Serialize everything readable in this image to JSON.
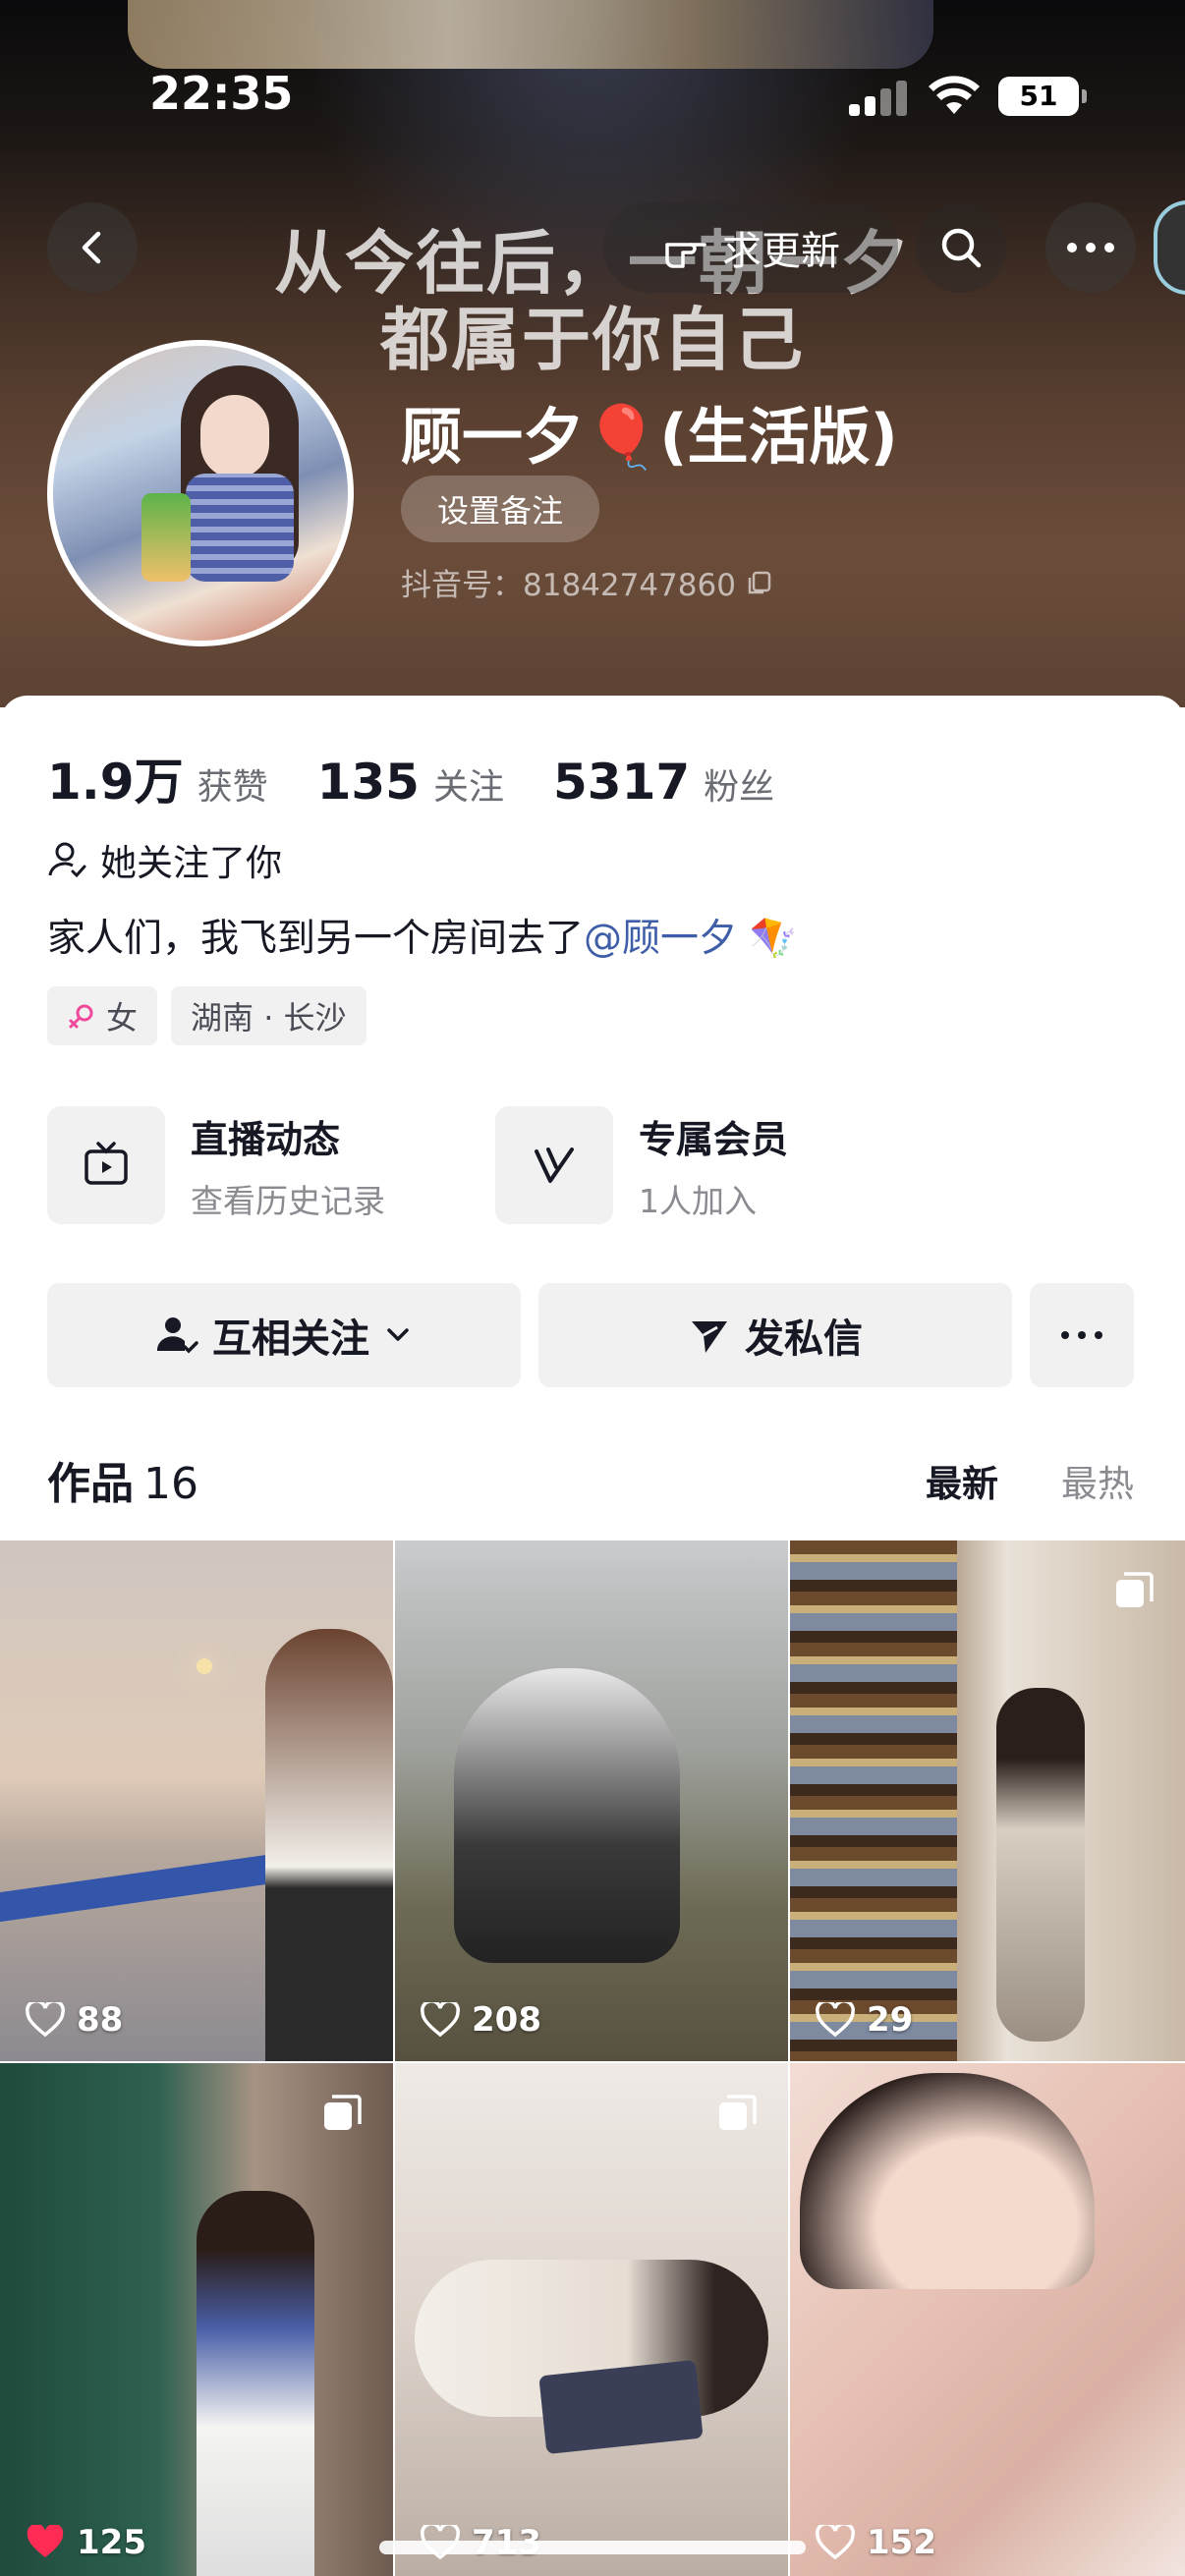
{
  "status_bar": {
    "time": "22:35",
    "battery": "51"
  },
  "banner": {
    "line1": "从今往后，一朝一夕",
    "line2": "都属于你自己"
  },
  "nav": {
    "update_label": "求更新"
  },
  "profile": {
    "name": "顾一夕🎈(生活版)",
    "remark_label": "设置备注",
    "douyin_id": "抖音号：81842747860"
  },
  "stats": [
    {
      "value": "1.9万",
      "label": "获赞"
    },
    {
      "value": "135",
      "label": "关注"
    },
    {
      "value": "5317",
      "label": "粉丝"
    }
  ],
  "follows_you": "她关注了你",
  "bio": {
    "text": "家人们，我飞到另一个房间去了",
    "mention": "@顾一夕",
    "emoji": "🪁"
  },
  "tags": {
    "gender": "女",
    "location": "湖南 · 长沙"
  },
  "features": [
    {
      "title": "直播动态",
      "subtitle": "查看历史记录",
      "icon": "tv-icon"
    },
    {
      "title": "专属会员",
      "subtitle": "1人加入",
      "icon": "v-badge-icon"
    }
  ],
  "actions": {
    "mutual_label": "互相关注",
    "dm_label": "发私信"
  },
  "works": {
    "title": "作品",
    "count": "16",
    "sort_new": "最新",
    "sort_hot": "最热"
  },
  "videos": [
    {
      "likes": "88",
      "liked": false,
      "multi": false
    },
    {
      "likes": "208",
      "liked": false,
      "multi": false
    },
    {
      "likes": "29",
      "liked": false,
      "multi": true
    },
    {
      "likes": "125",
      "liked": true,
      "multi": true
    },
    {
      "likes": "713",
      "liked": false,
      "multi": true
    },
    {
      "likes": "152",
      "liked": false,
      "multi": false
    }
  ],
  "colors": {
    "accent_like": "#fe2c55",
    "mention": "#3f5ea8"
  }
}
